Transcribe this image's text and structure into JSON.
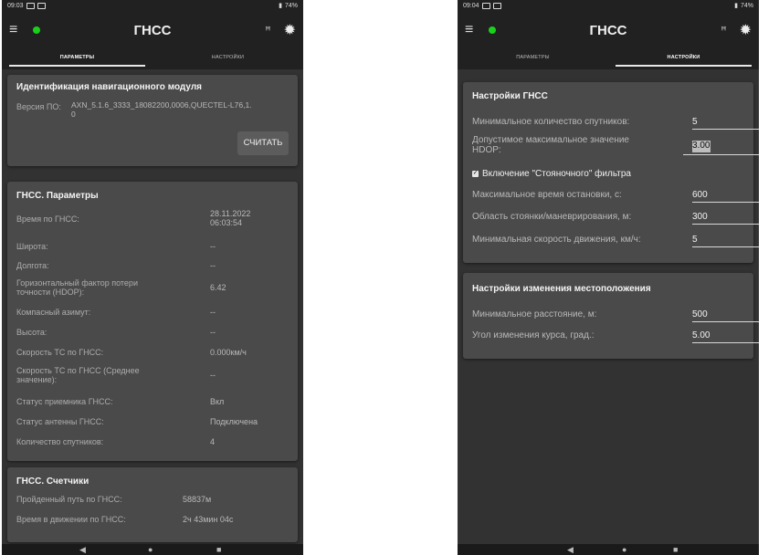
{
  "left": {
    "status_time": "09:03",
    "status_right": "74%",
    "app_title": "ГНСС",
    "tabs": [
      "ПАРАМЕТРЫ",
      "НАСТРОЙКИ"
    ],
    "module_card": {
      "title": "Идентификация навигационного модуля",
      "fw_label": "Версия ПО:",
      "fw_value_line1": "AXN_5.1.6_3333_18082200,0006,QUECTEL-L76,1.",
      "fw_value_line2": "0",
      "read_button": "СЧИТАТЬ"
    },
    "params_card": {
      "title": "ГНСС. Параметры",
      "rows": [
        {
          "label": "Время по ГНСС:",
          "value": "28.11.2022",
          "value2": "06:03:54"
        },
        {
          "label": "Широта:",
          "value": "--"
        },
        {
          "label": "Долгота:",
          "value": "--"
        },
        {
          "label": "Горизонтальный фактор потери",
          "label2": "точности (HDOP):",
          "value": "6.42"
        },
        {
          "label": "Компасный азимут:",
          "value": "--"
        },
        {
          "label": "Высота:",
          "value": "--"
        },
        {
          "label": "Скорость ТС по ГНСС:",
          "value": "0.000км/ч"
        },
        {
          "label": "Скорость ТС по ГНСС (Среднее",
          "label2": "значение):",
          "value": "--"
        },
        {
          "label": "Статус  приемника ГНСС:",
          "value": "Вкл"
        },
        {
          "label": "Статус антенны ГНСС:",
          "value": "Подключена"
        },
        {
          "label": "Количество  спутников:",
          "value": "4"
        }
      ]
    },
    "counters_card": {
      "title": "ГНСС. Счетчики",
      "rows": [
        {
          "label": "Пройденный путь по ГНСС:",
          "value": "58837м"
        },
        {
          "label": "Время в движении по ГНСС:",
          "value": "2ч 43мин 04с"
        }
      ]
    }
  },
  "right": {
    "status_time": "09:04",
    "status_right": "74%",
    "app_title": "ГНСС",
    "tabs": [
      "ПАРАМЕТРЫ",
      "НАСТРОЙКИ"
    ],
    "gnss_settings": {
      "title": "Настройки ГНСС",
      "rows": [
        {
          "label": "Минимальное количество спутников:",
          "value": "5"
        },
        {
          "label": "Допустимое максимальное значение",
          "label2": "HDOP:",
          "value": "3.00"
        },
        {
          "label": "Максимальное время остановки, с:",
          "value": "600"
        },
        {
          "label": "Область стоянки/маневрирования, м:",
          "value": "300"
        },
        {
          "label": "Минимальная скорость движения, км/ч:",
          "value": "5"
        }
      ],
      "checkbox_label": "Включение \"Стояночного\" фильтра",
      "checkbox_checked": true
    },
    "location_settings": {
      "title": "Настройки изменения местоположения",
      "rows": [
        {
          "label": "Минимальное расстояние, м:",
          "value": "500"
        },
        {
          "label": "Угол изменения курса, град.:",
          "value": "5.00"
        }
      ]
    }
  }
}
